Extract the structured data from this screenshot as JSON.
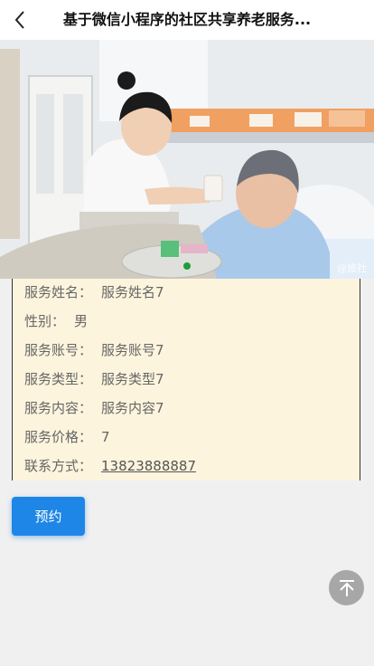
{
  "nav": {
    "title": "基于微信小程序的社区共享养老服务..."
  },
  "banner": {
    "watermark": "@旅社",
    "slide_count": 1,
    "active_slide": 1
  },
  "details": {
    "name_label": "服务姓名：",
    "name_value": "服务姓名7",
    "gender_label": "性别：",
    "gender_value": "男",
    "account_label": "服务账号：",
    "account_value": "服务账号7",
    "type_label": "服务类型：",
    "type_value": "服务类型7",
    "content_label": "服务内容：",
    "content_value": "服务内容7",
    "price_label": "服务价格：",
    "price_value": "7",
    "contact_label": "联系方式：",
    "contact_value": "13823888887"
  },
  "actions": {
    "book_label": "预约"
  },
  "icons": {
    "back": "chevron-left-icon",
    "top": "arrow-up-icon"
  },
  "colors": {
    "accent": "#1e86e6",
    "detail_bg": "#fdf4dd",
    "active_dot": "#1f9d3a"
  }
}
